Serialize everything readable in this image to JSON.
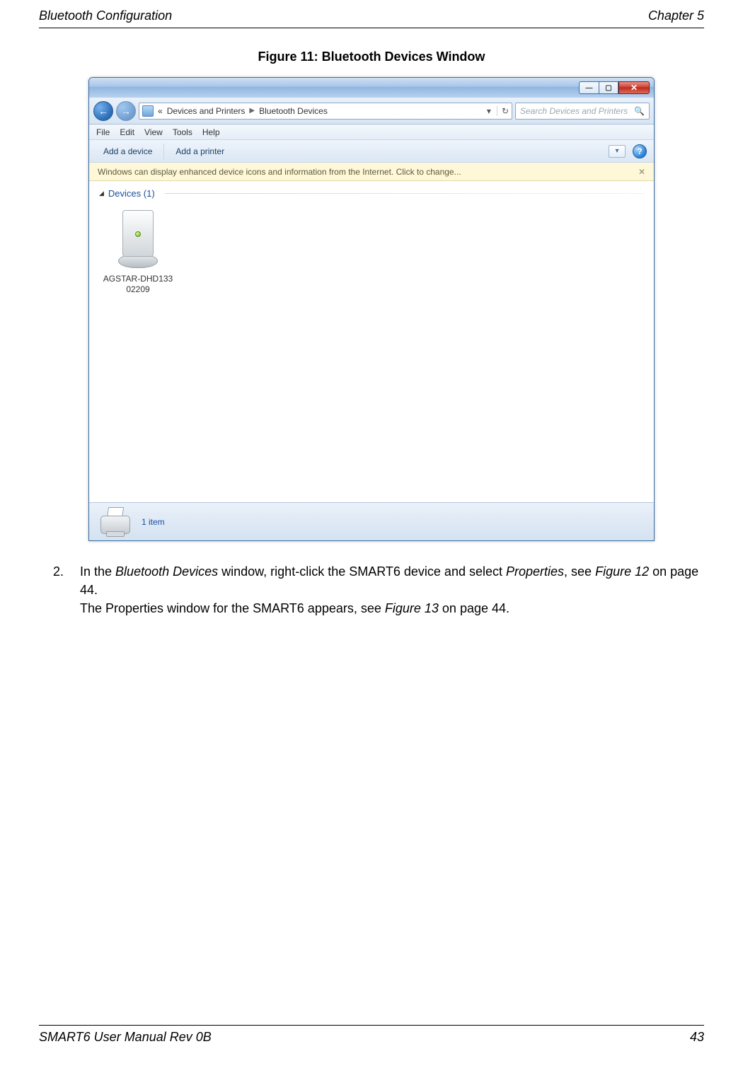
{
  "page_header": {
    "left": "Bluetooth Configuration",
    "right": "Chapter 5"
  },
  "page_footer": {
    "left": "SMART6 User Manual Rev 0B",
    "right": "43"
  },
  "figure_caption": "Figure 11: Bluetooth Devices Window",
  "window": {
    "title_controls": {
      "min": "—",
      "max": "▢",
      "close": "✕"
    },
    "nav": {
      "back": "←",
      "forward": "→"
    },
    "breadcrumb": {
      "lead": "«",
      "item1": "Devices and Printers",
      "sep1": "▶",
      "item2": "Bluetooth Devices",
      "drop": "▾",
      "refresh": "↻"
    },
    "search_placeholder": "Search Devices and Printers",
    "search_icon": "🔍",
    "menubar": {
      "file": "File",
      "edit": "Edit",
      "view": "View",
      "tools": "Tools",
      "help": "Help"
    },
    "toolbar": {
      "add_device": "Add a device",
      "add_printer": "Add a printer",
      "view_drop": "▾",
      "help": "?"
    },
    "infobar": {
      "text": "Windows can display enhanced device icons and information from the Internet. Click to change...",
      "close": "✕"
    },
    "group_header": {
      "caret": "◢",
      "label": "Devices (1)"
    },
    "device": {
      "line1": "AGSTAR-DHD133",
      "line2": "02209"
    },
    "statusbar": {
      "count": "1 item"
    }
  },
  "instruction": {
    "num": "2.",
    "t1": "In the ",
    "i1": "Bluetooth Devices",
    "t2": " window, right-click the SMART6 device and select ",
    "i2": "Properties",
    "t3": ", see ",
    "i3": "Figure 12",
    "t4": " on page 44.",
    "t5": "The Properties window for the SMART6 appears, see ",
    "i4": "Figure 13",
    "t6": " on page 44."
  }
}
